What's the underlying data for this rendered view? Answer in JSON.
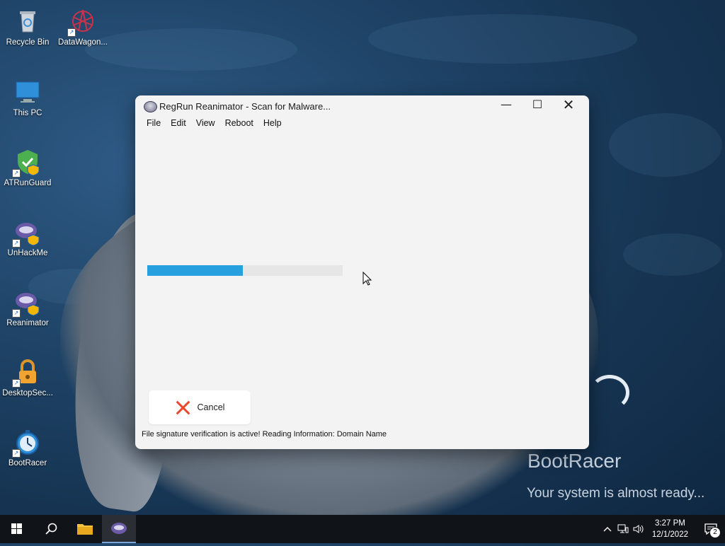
{
  "desktop": {
    "icons": [
      {
        "label": "Recycle Bin",
        "icon": "recycle-bin-icon"
      },
      {
        "label": "DataWagon...",
        "icon": "datawagon-icon"
      },
      {
        "label": "This PC",
        "icon": "computer-icon"
      },
      {
        "label": "ATRunGuard",
        "icon": "shield-check-icon"
      },
      {
        "label": "UnHackMe",
        "icon": "unhackme-icon"
      },
      {
        "label": "Reanimator",
        "icon": "reanimator-icon"
      },
      {
        "label": "DesktopSec...",
        "icon": "padlock-icon"
      },
      {
        "label": "BootRacer",
        "icon": "stopwatch-icon"
      }
    ],
    "bootracer": {
      "title": "BootRacer",
      "subtitle": "Your system is almost ready..."
    }
  },
  "window": {
    "title": "RegRun Reanimator - Scan for Malware...",
    "controls": {
      "minimize": "—",
      "maximize": "☐",
      "close": "✕"
    },
    "menu": [
      "File",
      "Edit",
      "View",
      "Reboot",
      "Help"
    ],
    "progress": 0.49,
    "cancel_label": "Cancel",
    "status": "File signature verification is active! Reading Information: Domain Name",
    "accent": "#27a0e0",
    "cancel_color": "#e8492e"
  },
  "taskbar": {
    "time": "3:27 PM",
    "date": "12/1/2022",
    "notification_count": "2"
  }
}
